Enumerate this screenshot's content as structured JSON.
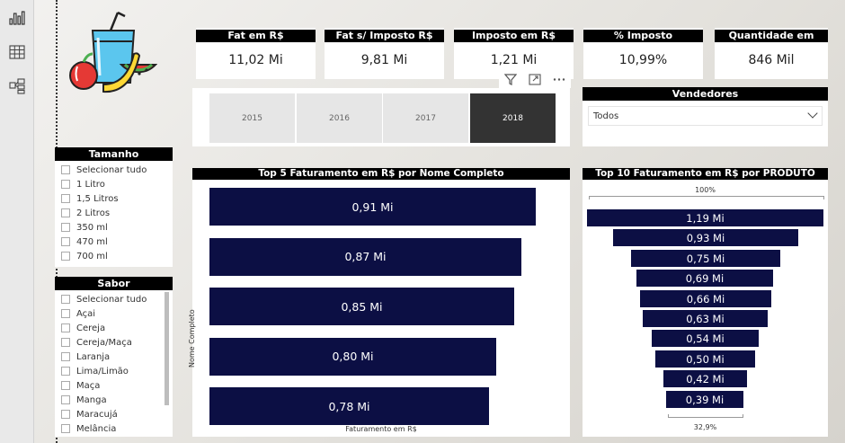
{
  "kpis": [
    {
      "label": "Fat em R$",
      "value": "11,02 Mi"
    },
    {
      "label": "Fat s/ Imposto R$",
      "value": "9,81 Mi"
    },
    {
      "label": "Imposto em R$",
      "value": "1,21 Mi"
    },
    {
      "label": "% Imposto",
      "value": "10,99%"
    },
    {
      "label": "Quantidade em Litros",
      "value": "846 Mil"
    }
  ],
  "years": {
    "options": [
      "2015",
      "2016",
      "2017",
      "2018"
    ],
    "selected": "2018"
  },
  "vendedores": {
    "title": "Vendedores",
    "selected": "Todos"
  },
  "tamanho": {
    "title": "Tamanho",
    "items": [
      "Selecionar tudo",
      "1 Litro",
      "1,5 Litros",
      "2 Litros",
      "350 ml",
      "470 ml",
      "700 ml"
    ]
  },
  "sabor": {
    "title": "Sabor",
    "items": [
      "Selecionar tudo",
      "Açai",
      "Cereja",
      "Cereja/Maça",
      "Laranja",
      "Lima/Limão",
      "Maça",
      "Manga",
      "Maracujá",
      "Melância"
    ]
  },
  "icons": [
    "filter-icon",
    "focus-mode-icon",
    "more-options-icon",
    "report-view-icon",
    "data-view-icon",
    "model-view-icon",
    "fruit-juice-logo"
  ],
  "chart_data": [
    {
      "type": "bar",
      "orientation": "horizontal",
      "title": "Top 5 Faturamento em R$ por Nome Completo",
      "xlabel": "Faturamento em R$",
      "ylabel": "Nome Completo",
      "categories": [],
      "values": [
        0.91,
        0.87,
        0.85,
        0.8,
        0.78
      ],
      "labels": [
        "0,91 Mi",
        "0,87 Mi",
        "0,85 Mi",
        "0,80 Mi",
        "0,78 Mi"
      ],
      "xlim": [
        0,
        0.91
      ]
    },
    {
      "type": "funnel",
      "title": "Top 10 Faturamento em R$ por PRODUTO",
      "categories": [],
      "values": [
        1.19,
        0.93,
        0.75,
        0.69,
        0.66,
        0.63,
        0.54,
        0.5,
        0.42,
        0.39
      ],
      "labels": [
        "1,19 Mi",
        "0,93 Mi",
        "0,75 Mi",
        "0,69 Mi",
        "0,66 Mi",
        "0,63 Mi",
        "0,54 Mi",
        "0,50 Mi",
        "0,42 Mi",
        "0,39 Mi"
      ],
      "top_percent": "100%",
      "bottom_percent": "32,9%"
    }
  ]
}
